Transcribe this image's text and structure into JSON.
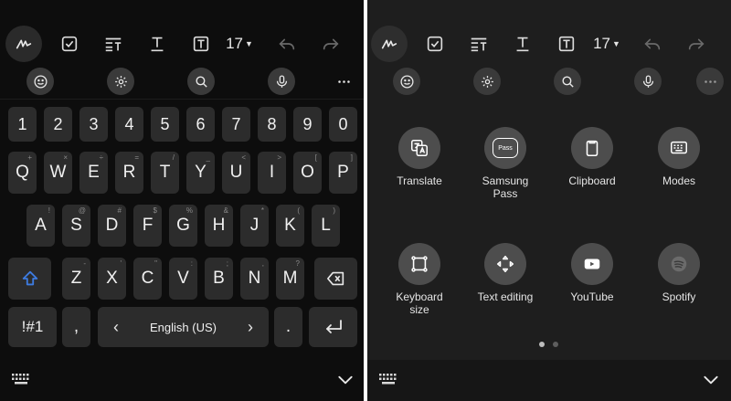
{
  "left": {
    "toolbar": {
      "font_size": "17"
    },
    "number_row": [
      "1",
      "2",
      "3",
      "4",
      "5",
      "6",
      "7",
      "8",
      "9",
      "0"
    ],
    "qwerty_row": [
      {
        "k": "Q",
        "s": "+"
      },
      {
        "k": "W",
        "s": "×"
      },
      {
        "k": "E",
        "s": "÷"
      },
      {
        "k": "R",
        "s": "="
      },
      {
        "k": "T",
        "s": "/"
      },
      {
        "k": "Y",
        "s": "_"
      },
      {
        "k": "U",
        "s": "<"
      },
      {
        "k": "I",
        "s": ">"
      },
      {
        "k": "O",
        "s": "["
      },
      {
        "k": "P",
        "s": "]"
      }
    ],
    "asdf_row": [
      {
        "k": "A",
        "s": "!"
      },
      {
        "k": "S",
        "s": "@"
      },
      {
        "k": "D",
        "s": "#"
      },
      {
        "k": "F",
        "s": "$"
      },
      {
        "k": "G",
        "s": "%"
      },
      {
        "k": "H",
        "s": "&"
      },
      {
        "k": "J",
        "s": "*"
      },
      {
        "k": "K",
        "s": "("
      },
      {
        "k": "L",
        "s": ")"
      }
    ],
    "zxcv_row": [
      {
        "k": "Z",
        "s": "-"
      },
      {
        "k": "X",
        "s": "'"
      },
      {
        "k": "C",
        "s": "\""
      },
      {
        "k": "V",
        "s": ":"
      },
      {
        "k": "B",
        "s": ";"
      },
      {
        "k": "N",
        "s": ","
      },
      {
        "k": "M",
        "s": "?"
      }
    ],
    "symbols_key": "!#1",
    "comma_key": ",",
    "space_label": "English (US)",
    "period_key": ".",
    "space_left_arrow": "‹",
    "space_right_arrow": "›"
  },
  "right": {
    "toolbar": {
      "font_size": "17"
    },
    "grid": [
      {
        "label": "Translate",
        "icon": "translate-icon"
      },
      {
        "label": "Samsung\nPass",
        "icon": "samsung-pass-icon",
        "icon_text": "Pass"
      },
      {
        "label": "Clipboard",
        "icon": "clipboard-icon"
      },
      {
        "label": "Modes",
        "icon": "modes-icon"
      },
      {
        "label": "Keyboard\nsize",
        "icon": "keyboard-size-icon"
      },
      {
        "label": "Text editing",
        "icon": "text-editing-icon"
      },
      {
        "label": "YouTube",
        "icon": "youtube-icon"
      },
      {
        "label": "Spotify",
        "icon": "spotify-icon"
      }
    ],
    "page_indicator": {
      "pages": 2,
      "current": 1
    }
  },
  "colors": {
    "left_bg": "#0d0d0d",
    "right_bg": "#1e1e1e",
    "key_bg": "#2c2c2c",
    "shift_blue": "#3d7be0"
  }
}
